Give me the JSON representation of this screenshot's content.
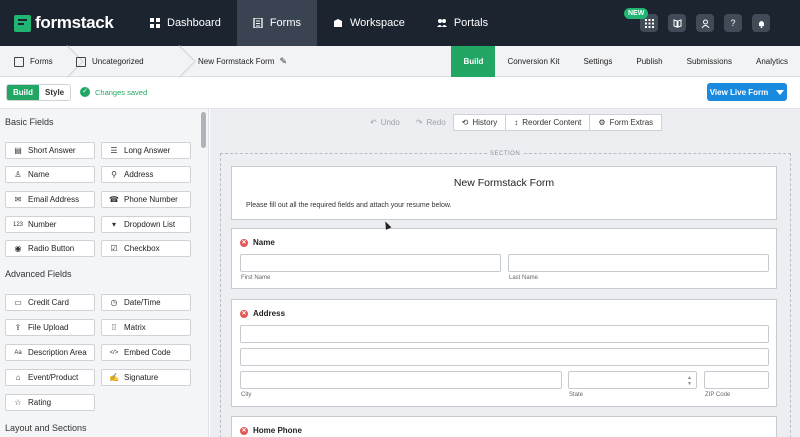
{
  "topnav": {
    "brand": "formstack",
    "items": [
      "Dashboard",
      "Forms",
      "Workspace",
      "Portals"
    ],
    "new_badge": "NEW"
  },
  "breadcrumb": {
    "forms": "Forms",
    "folder": "Uncategorized",
    "form_name": "New Formstack Form"
  },
  "tabs": [
    "Build",
    "Conversion Kit",
    "Settings",
    "Publish",
    "Submissions",
    "Analytics"
  ],
  "toolbar": {
    "build": "Build",
    "style": "Style",
    "saved": "Changes saved",
    "view_live": "View Live Form"
  },
  "canvas_toolbar": {
    "undo": "Undo",
    "redo": "Redo",
    "history": "History",
    "reorder": "Reorder Content",
    "extras": "Form Extras"
  },
  "sidebar": {
    "basic_title": "Basic Fields",
    "basic": [
      "Short Answer",
      "Long Answer",
      "Name",
      "Address",
      "Email Address",
      "Phone Number",
      "Number",
      "Dropdown List",
      "Radio Button",
      "Checkbox"
    ],
    "advanced_title": "Advanced Fields",
    "advanced": [
      "Credit Card",
      "Date/Time",
      "File Upload",
      "Matrix",
      "Description Area",
      "Embed Code",
      "Event/Product",
      "Signature",
      "Rating"
    ],
    "layout_title": "Layout and Sections"
  },
  "form": {
    "section_label": "SECTION",
    "title": "New Formstack Form",
    "description": "Please fill out all the required fields and attach your resume below.",
    "name_label": "Name",
    "first_name": "First Name",
    "last_name": "Last Name",
    "address_label": "Address",
    "city": "City",
    "state": "State",
    "zip": "ZIP Code",
    "home_phone": "Home Phone"
  },
  "colors": {
    "nav_bg": "#1c2430",
    "accent_green": "#21a663",
    "live_blue": "#1a8ae0",
    "required_red": "#e25555"
  }
}
